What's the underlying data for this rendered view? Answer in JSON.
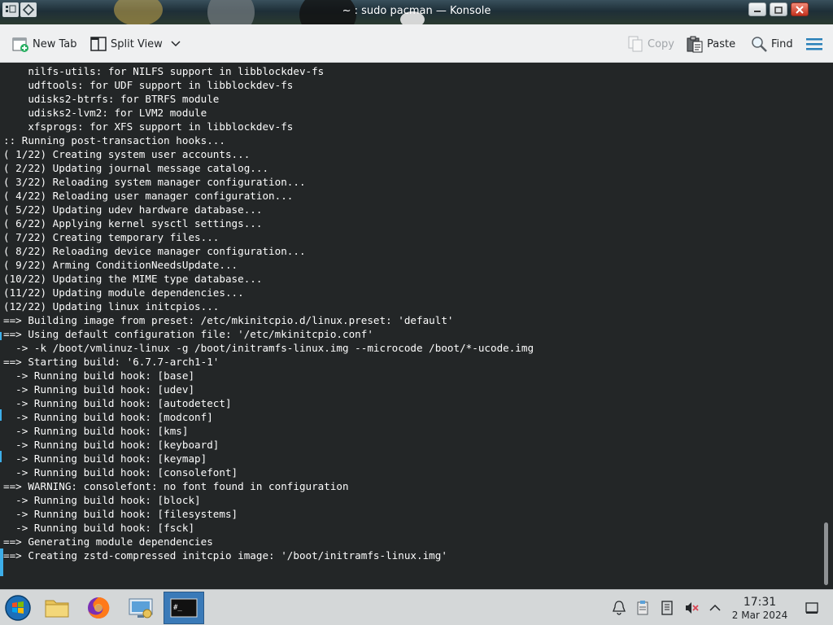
{
  "window": {
    "title": "~ : sudo pacman — Konsole"
  },
  "toolbar": {
    "new_tab_label": "New Tab",
    "split_view_label": "Split View",
    "copy_label": "Copy",
    "paste_label": "Paste",
    "find_label": "Find"
  },
  "terminal": {
    "lines": [
      "    nilfs-utils: for NILFS support in libblockdev-fs",
      "    udftools: for UDF support in libblockdev-fs",
      "    udisks2-btrfs: for BTRFS module",
      "    udisks2-lvm2: for LVM2 module",
      "    xfsprogs: for XFS support in libblockdev-fs",
      ":: Running post-transaction hooks...",
      "( 1/22) Creating system user accounts...",
      "( 2/22) Updating journal message catalog...",
      "( 3/22) Reloading system manager configuration...",
      "( 4/22) Reloading user manager configuration...",
      "( 5/22) Updating udev hardware database...",
      "( 6/22) Applying kernel sysctl settings...",
      "( 7/22) Creating temporary files...",
      "( 8/22) Reloading device manager configuration...",
      "( 9/22) Arming ConditionNeedsUpdate...",
      "(10/22) Updating the MIME type database...",
      "(11/22) Updating module dependencies...",
      "(12/22) Updating linux initcpios...",
      "==> Building image from preset: /etc/mkinitcpio.d/linux.preset: 'default'",
      "==> Using default configuration file: '/etc/mkinitcpio.conf'",
      "  -> -k /boot/vmlinuz-linux -g /boot/initramfs-linux.img --microcode /boot/*-ucode.img",
      "==> Starting build: '6.7.7-arch1-1'",
      "  -> Running build hook: [base]",
      "  -> Running build hook: [udev]",
      "  -> Running build hook: [autodetect]",
      "  -> Running build hook: [modconf]",
      "  -> Running build hook: [kms]",
      "  -> Running build hook: [keyboard]",
      "  -> Running build hook: [keymap]",
      "  -> Running build hook: [consolefont]",
      "==> WARNING: consolefont: no font found in configuration",
      "  -> Running build hook: [block]",
      "  -> Running build hook: [filesystems]",
      "  -> Running build hook: [fsck]",
      "==> Generating module dependencies",
      "==> Creating zstd-compressed initcpio image: '/boot/initramfs-linux.img'"
    ]
  },
  "taskbar": {
    "items": [
      {
        "icon": "start-menu-icon"
      },
      {
        "icon": "file-manager-icon"
      },
      {
        "icon": "firefox-icon"
      },
      {
        "icon": "system-settings-icon"
      },
      {
        "icon": "konsole-icon",
        "active": true
      }
    ],
    "tray": [
      "notification-bell-icon",
      "clipboard-icon",
      "task-manager-icon",
      "volume-muted-icon",
      "expand-tray-icon",
      "show-desktop-icon"
    ],
    "clock_time": "17:31",
    "clock_date": "2 Mar 2024"
  },
  "colors": {
    "terminal_bg": "#232627",
    "terminal_fg": "#fcfcfc",
    "accent": "#3daee9",
    "toolbar_bg": "#eff0f1",
    "taskbar_bg": "#d4d7d8"
  }
}
